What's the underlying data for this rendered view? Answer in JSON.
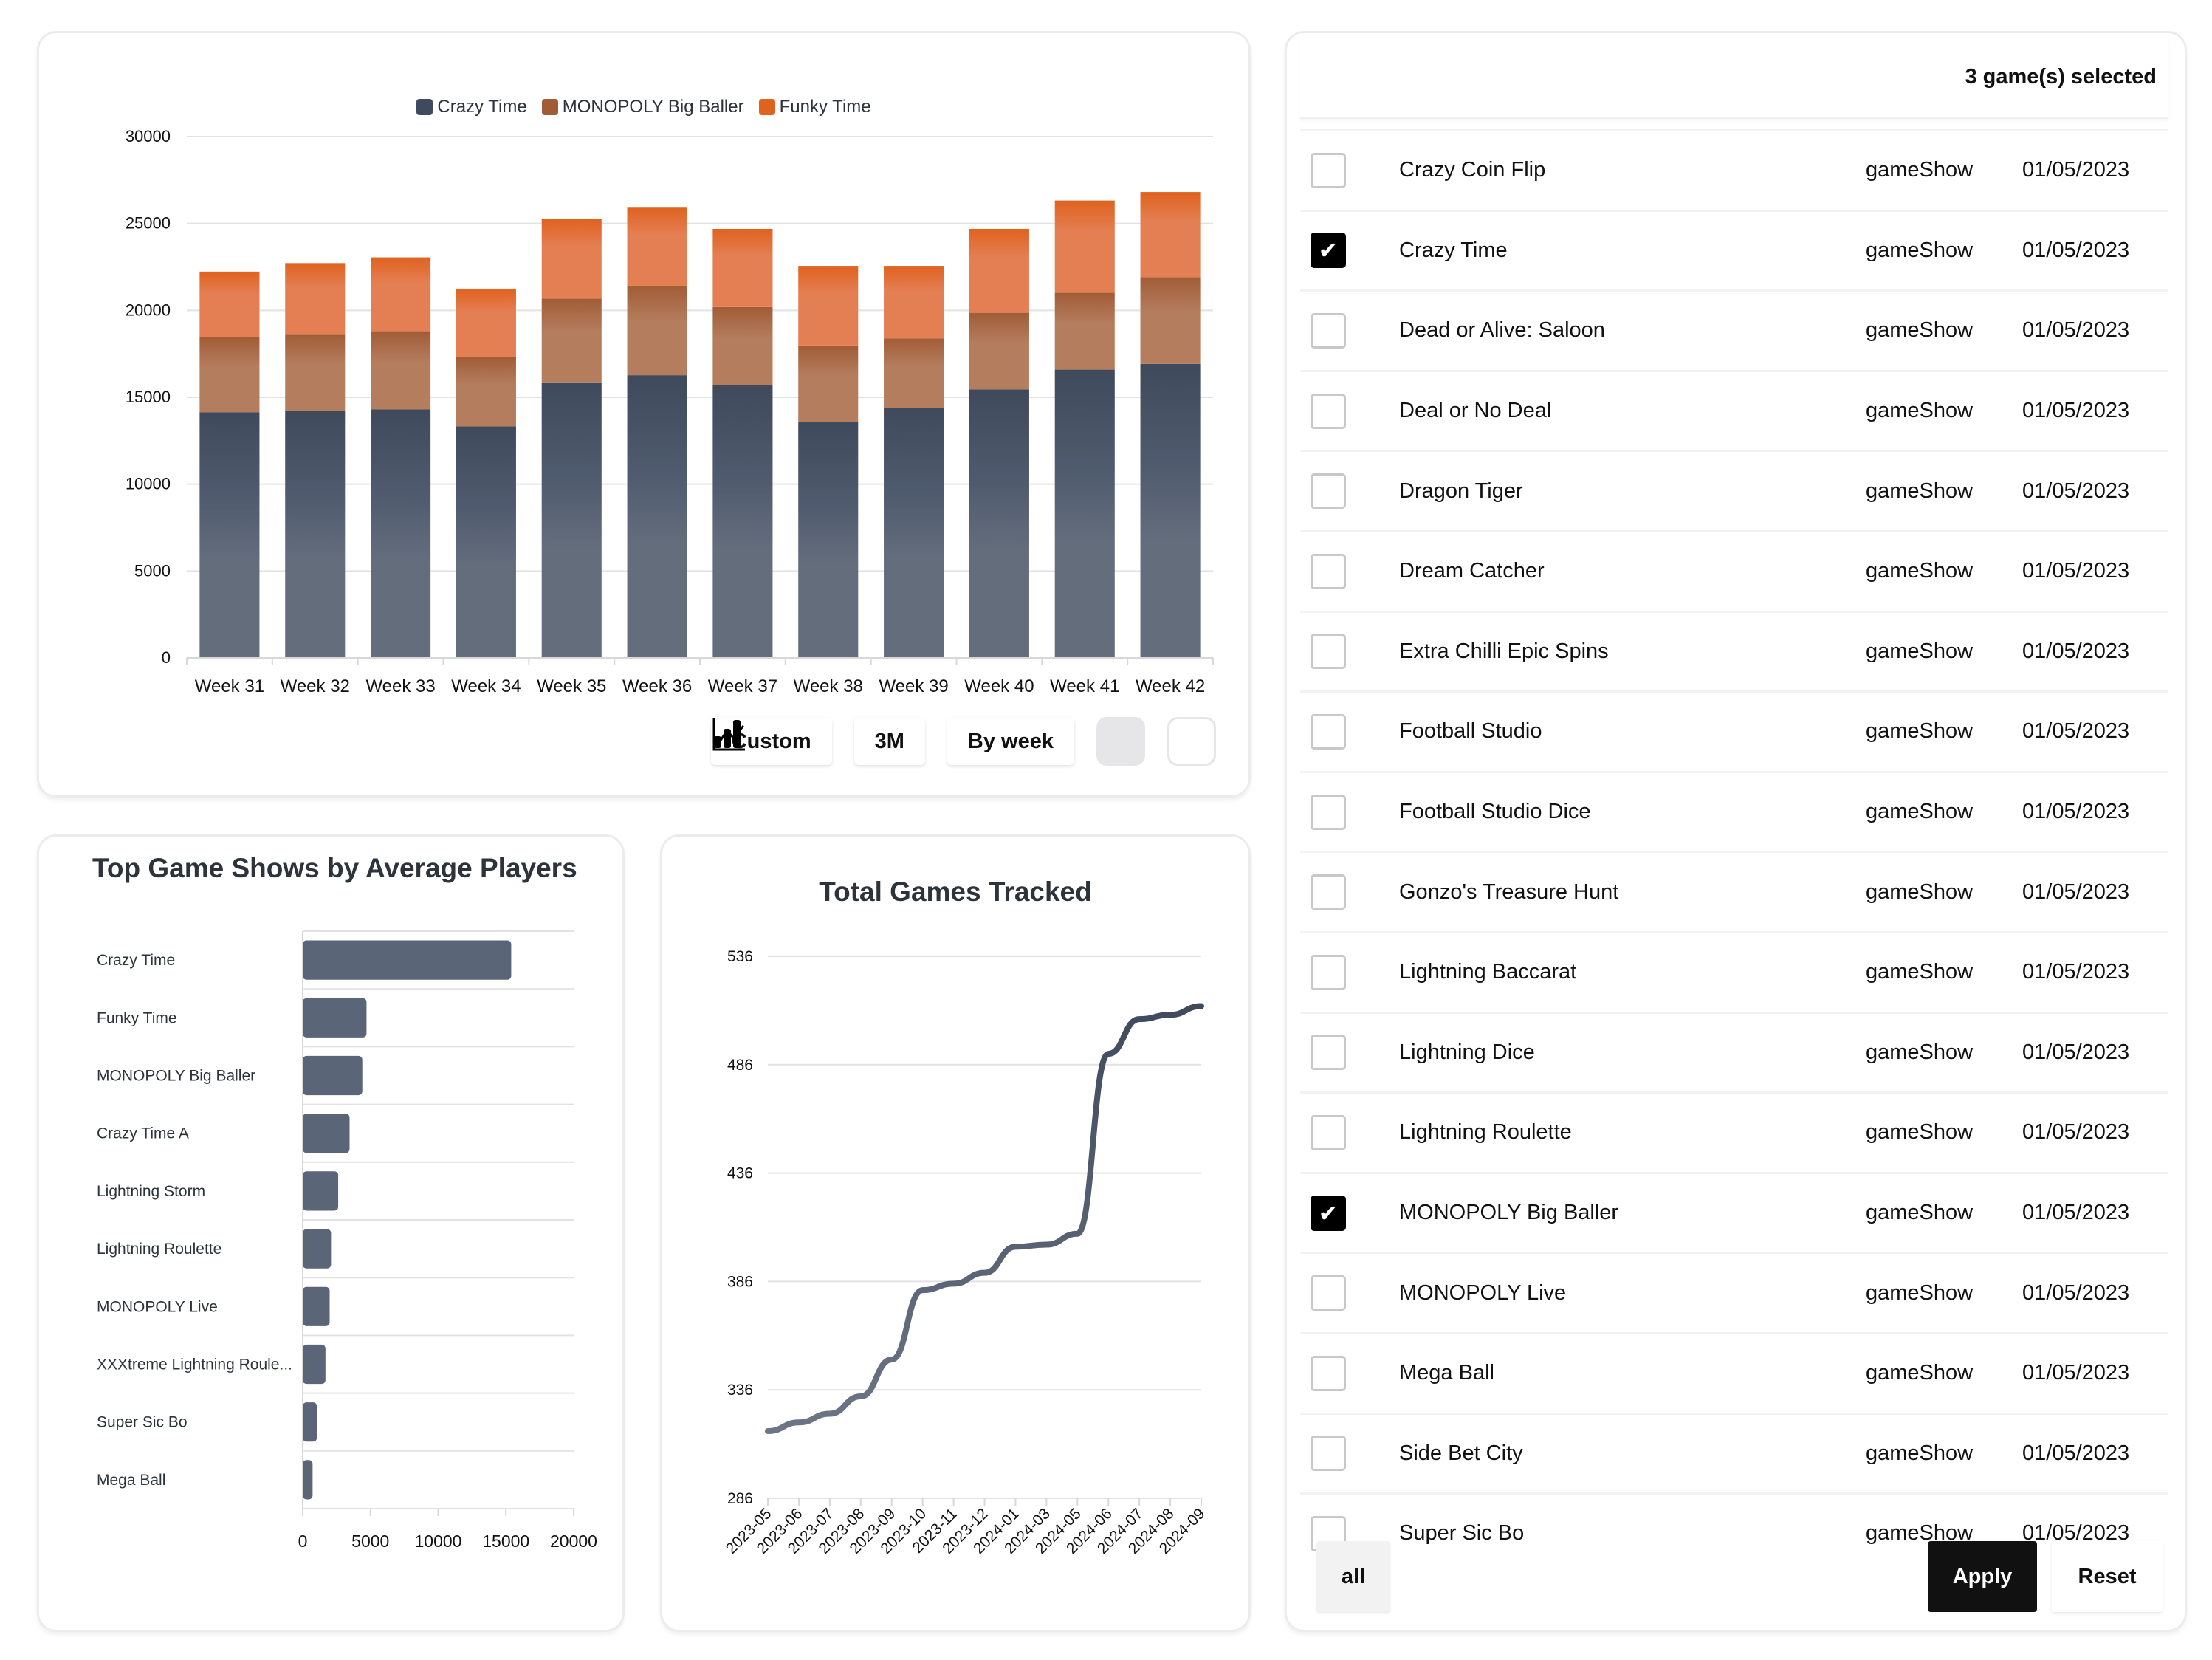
{
  "main_chart": {
    "legend": [
      {
        "name": "Crazy Time",
        "color": "#3f4a5c"
      },
      {
        "name": "MONOPOLY Big Baller",
        "color": "#a15c36"
      },
      {
        "name": "Funky Time",
        "color": "#e0621f"
      }
    ],
    "controls": {
      "custom_label": "Custom",
      "period_label": "3M",
      "granularity_label": "By week",
      "bar_view_icon": "bar-chart-icon",
      "line_view_icon": "line-chart-icon",
      "active_view": "bar"
    }
  },
  "top_shows": {
    "title": "Top Game Shows by Average Players"
  },
  "total_games": {
    "title": "Total Games Tracked"
  },
  "chart_data": [
    {
      "type": "bar",
      "stacked": true,
      "title": "",
      "categories": [
        "Week 31",
        "Week 32",
        "Week 33",
        "Week 34",
        "Week 35",
        "Week 36",
        "Week 37",
        "Week 38",
        "Week 39",
        "Week 40",
        "Week 41",
        "Week 42"
      ],
      "series": [
        {
          "name": "Crazy Time",
          "color": "#3f4a5c",
          "values": [
            14140,
            14220,
            14300,
            13320,
            15860,
            16270,
            15690,
            13570,
            14390,
            15450,
            16590,
            16920
          ]
        },
        {
          "name": "MONOPOLY Big Baller",
          "color": "#a15c36",
          "values": [
            4330,
            4420,
            4500,
            4010,
            4820,
            5150,
            4500,
            4410,
            4000,
            4410,
            4420,
            4990
          ]
        },
        {
          "name": "Funky Time",
          "color": "#e0621f",
          "values": [
            3760,
            4080,
            4250,
            3920,
            4580,
            4490,
            4500,
            4580,
            4170,
            4830,
            5310,
            4900
          ]
        }
      ],
      "xlabel": "",
      "ylabel": "",
      "ylim": [
        0,
        30000
      ],
      "yticks": [
        0,
        5000,
        10000,
        15000,
        20000,
        25000,
        30000
      ],
      "grid": true,
      "legend": "top-center"
    },
    {
      "type": "bar",
      "orientation": "horizontal",
      "title": "Top Game Shows by Average Players",
      "categories": [
        "Crazy Time",
        "Funky Time",
        "MONOPOLY Big Baller",
        "Crazy Time A",
        "Lightning Storm",
        "Lightning Roulette",
        "MONOPOLY Live",
        "XXXtreme Lightning Roule...",
        "Super Sic Bo",
        "Mega Ball"
      ],
      "values": [
        15390,
        4710,
        4400,
        3460,
        2620,
        2090,
        1990,
        1680,
        1050,
        730
      ],
      "color": "#5a6577",
      "xlim": [
        0,
        20000
      ],
      "xticks": [
        0,
        5000,
        10000,
        15000,
        20000
      ],
      "grid": true
    },
    {
      "type": "line",
      "title": "Total Games Tracked",
      "x": [
        "2023-05",
        "2023-06",
        "2023-07",
        "2023-08",
        "2023-09",
        "2023-10",
        "2023-11",
        "2023-12",
        "2024-01",
        "2024-03",
        "2024-05",
        "2024-06",
        "2024-07",
        "2024-08",
        "2024-09"
      ],
      "values": [
        317,
        321,
        325,
        333,
        350,
        382,
        385,
        390,
        402,
        403,
        408,
        491,
        507,
        509,
        513
      ],
      "ylim": [
        286,
        536
      ],
      "yticks": [
        286,
        336,
        386,
        436,
        486,
        536
      ],
      "color_top": "#3f4a5c",
      "color_bottom": "#6b7585",
      "grid": true
    }
  ],
  "game_list": {
    "selected_count_label": "3 game(s) selected",
    "rows": [
      {
        "name": "Crazy Coin Flip",
        "type": "gameShow",
        "date": "01/05/2023",
        "checked": false
      },
      {
        "name": "Crazy Time",
        "type": "gameShow",
        "date": "01/05/2023",
        "checked": true
      },
      {
        "name": "Dead or Alive: Saloon",
        "type": "gameShow",
        "date": "01/05/2023",
        "checked": false
      },
      {
        "name": "Deal or No Deal",
        "type": "gameShow",
        "date": "01/05/2023",
        "checked": false
      },
      {
        "name": "Dragon Tiger",
        "type": "gameShow",
        "date": "01/05/2023",
        "checked": false
      },
      {
        "name": "Dream Catcher",
        "type": "gameShow",
        "date": "01/05/2023",
        "checked": false
      },
      {
        "name": "Extra Chilli Epic Spins",
        "type": "gameShow",
        "date": "01/05/2023",
        "checked": false
      },
      {
        "name": "Football Studio",
        "type": "gameShow",
        "date": "01/05/2023",
        "checked": false
      },
      {
        "name": "Football Studio Dice",
        "type": "gameShow",
        "date": "01/05/2023",
        "checked": false
      },
      {
        "name": "Gonzo's Treasure Hunt",
        "type": "gameShow",
        "date": "01/05/2023",
        "checked": false
      },
      {
        "name": "Lightning Baccarat",
        "type": "gameShow",
        "date": "01/05/2023",
        "checked": false
      },
      {
        "name": "Lightning Dice",
        "type": "gameShow",
        "date": "01/05/2023",
        "checked": false
      },
      {
        "name": "Lightning Roulette",
        "type": "gameShow",
        "date": "01/05/2023",
        "checked": false
      },
      {
        "name": "MONOPOLY Big Baller",
        "type": "gameShow",
        "date": "01/05/2023",
        "checked": true
      },
      {
        "name": "MONOPOLY Live",
        "type": "gameShow",
        "date": "01/05/2023",
        "checked": false
      },
      {
        "name": "Mega Ball",
        "type": "gameShow",
        "date": "01/05/2023",
        "checked": false
      },
      {
        "name": "Side Bet City",
        "type": "gameShow",
        "date": "01/05/2023",
        "checked": false
      },
      {
        "name": "Super Sic Bo",
        "type": "gameShow",
        "date": "01/05/2023",
        "checked": false
      }
    ],
    "footer": {
      "all_label": "all",
      "apply_label": "Apply",
      "reset_label": "Reset"
    }
  }
}
